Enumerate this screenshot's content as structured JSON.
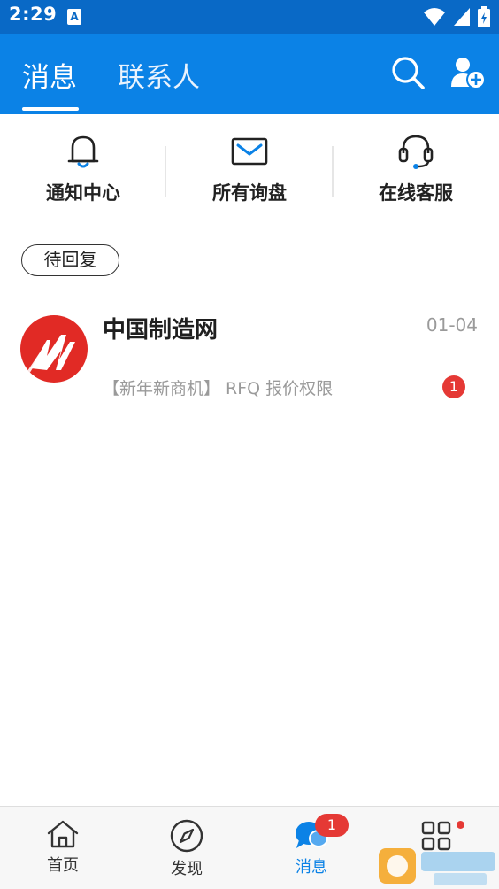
{
  "status_bar": {
    "time": "2:29",
    "notification_badge": "A",
    "icons": [
      "wifi-icon",
      "signal-icon",
      "battery-icon"
    ]
  },
  "header": {
    "tabs": [
      {
        "label": "消息",
        "active": true
      },
      {
        "label": "联系人",
        "active": false
      }
    ],
    "actions": [
      "search-icon",
      "add-contact-icon"
    ],
    "background_color": "#0b82e6"
  },
  "quick_actions": [
    {
      "label": "通知中心",
      "icon": "bell-icon"
    },
    {
      "label": "所有询盘",
      "icon": "envelope-icon"
    },
    {
      "label": "在线客服",
      "icon": "headset-icon"
    }
  ],
  "filter": {
    "label": "待回复"
  },
  "conversations": [
    {
      "name": "中国制造网",
      "date": "01-04",
      "preview": "【新年新商机】 RFQ 报价权限",
      "unread": "1",
      "avatar_icon": "made-in-china-logo"
    }
  ],
  "bottom_nav": {
    "items": [
      {
        "label": "首页",
        "icon": "home-icon",
        "active": false
      },
      {
        "label": "发现",
        "icon": "compass-icon",
        "active": false
      },
      {
        "label": "消息",
        "icon": "chat-icon",
        "active": true,
        "badge": "1"
      },
      {
        "label": "",
        "icon": "apps-grid-icon",
        "active": false,
        "dot": true
      }
    ]
  },
  "colors": {
    "accent": "#0b82e6",
    "status_bar": "#0969c6",
    "badge": "#e53935",
    "logo_red": "#e12a25"
  }
}
